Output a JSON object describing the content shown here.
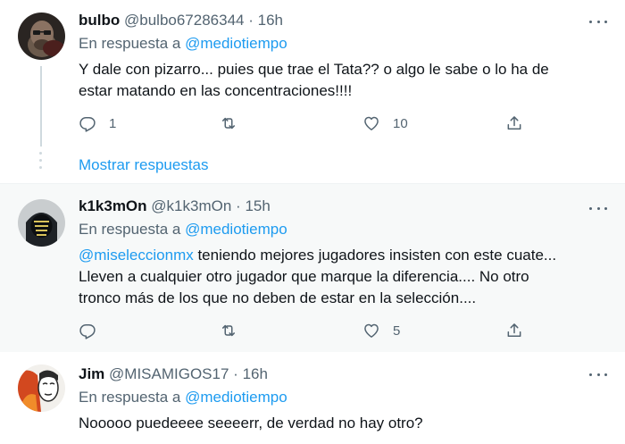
{
  "tweets": [
    {
      "name": "bulbo",
      "handle": "@bulbo67286344",
      "time": "16h",
      "reply_prefix": "En respuesta a",
      "reply_to": "@mediotiempo",
      "text_line1": "Y dale con pizarro...  puies que trae el Tata?? o algo le sabe o lo ha de",
      "text_line2": "estar matando en las concentraciones!!!!",
      "replies": "1",
      "retweets": "",
      "likes": "10",
      "show_replies": "Mostrar respuestas"
    },
    {
      "name": "k1k3mOn",
      "handle": "@k1k3mOn",
      "time": "15h",
      "reply_prefix": "En respuesta a",
      "reply_to": "@mediotiempo",
      "mention": "@miseleccionmx",
      "text_line1": " teniendo mejores jugadores insisten con este cuate...",
      "text_line2": "Lleven a cualquier otro jugador que marque la diferencia.... No otro",
      "text_line3": "tronco más de los que no deben de estar en la selección....",
      "replies": "",
      "retweets": "",
      "likes": "5"
    },
    {
      "name": "Jim",
      "handle": "@MISAMIGOS17",
      "time": "16h",
      "reply_prefix": "En respuesta a",
      "reply_to": "@mediotiempo",
      "text_line1": "Nooooo puedeeee seeeerr, de verdad no hay otro?"
    }
  ],
  "separator": "·",
  "icons": {
    "reply": "reply-icon",
    "retweet": "retweet-icon",
    "like": "heart-icon",
    "share": "share-icon",
    "more": "more-icon"
  },
  "colors": {
    "accent": "#1d9bf0",
    "secondary_text": "#536471",
    "highlight_bg": "#f7f9f9"
  }
}
